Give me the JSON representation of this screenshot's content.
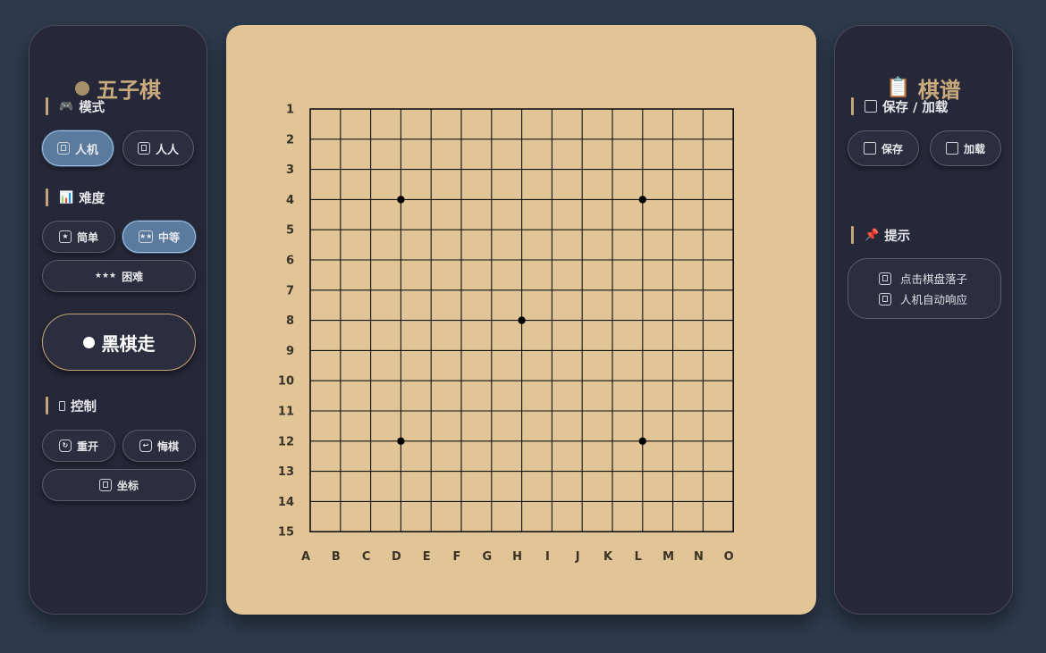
{
  "left_panel": {
    "title": "五子棋",
    "mode": {
      "label": "模式",
      "buttons": [
        {
          "label": "人机",
          "active": true
        },
        {
          "label": "人人",
          "active": false
        }
      ]
    },
    "difficulty": {
      "label": "难度",
      "buttons": [
        {
          "label": "简单",
          "icon": "★",
          "active": false
        },
        {
          "label": "中等",
          "icon": "★★",
          "active": true
        },
        {
          "label": "困难",
          "icon": "★★★",
          "active": false
        }
      ]
    },
    "turn": {
      "label": "黑棋走"
    },
    "control": {
      "label": "控制",
      "restart_label": "重开",
      "undo_label": "悔棋",
      "coords_label": "坐标"
    }
  },
  "right_panel": {
    "title": "棋谱",
    "save_load": {
      "label": "保存 / 加载",
      "save_label": "保存",
      "load_label": "加载"
    },
    "tips": {
      "label": "提示",
      "lines": [
        "点击棋盘落子",
        "人机自动响应"
      ]
    }
  },
  "board": {
    "size": 15,
    "row_labels": [
      "1",
      "2",
      "3",
      "4",
      "5",
      "6",
      "7",
      "8",
      "9",
      "10",
      "11",
      "12",
      "13",
      "14",
      "15"
    ],
    "col_labels": [
      "A",
      "B",
      "C",
      "D",
      "E",
      "F",
      "G",
      "H",
      "I",
      "J",
      "K",
      "L",
      "M",
      "N",
      "O"
    ],
    "star_points": [
      [
        4,
        4
      ],
      [
        4,
        12
      ],
      [
        8,
        8
      ],
      [
        12,
        4
      ],
      [
        12,
        12
      ]
    ],
    "stones": [],
    "colors": {
      "board": "#e2c596",
      "line": "#111111",
      "accent": "#c4a57a",
      "active": "#5a7a9e"
    }
  }
}
